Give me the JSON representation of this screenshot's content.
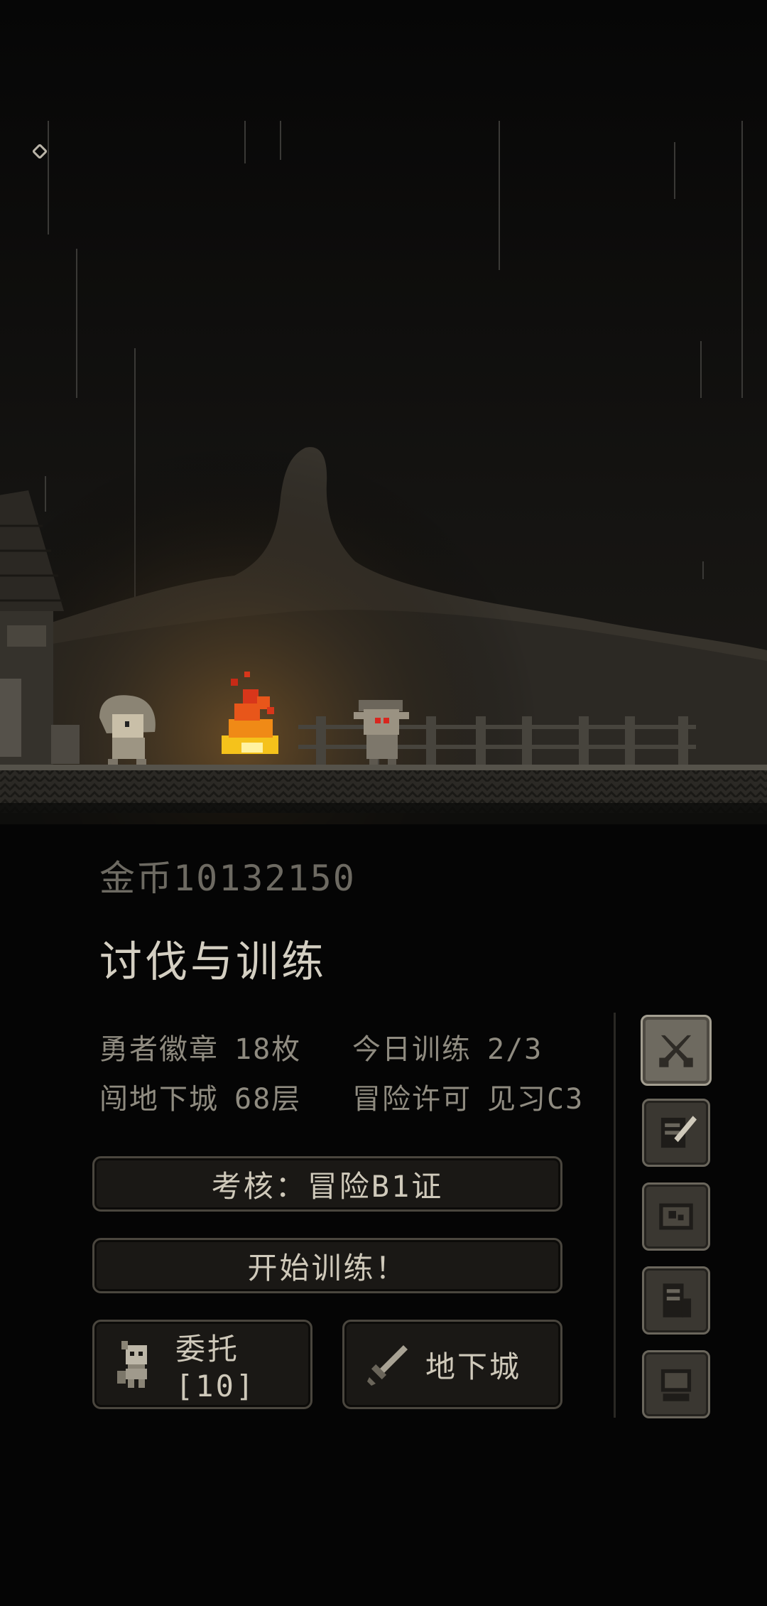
{
  "gold": "金币10132150",
  "panel_title": "讨伐与训练",
  "stats": [
    {
      "label": "勇者徽章",
      "value": "18枚"
    },
    {
      "label": "今日训练",
      "value": "2/3"
    },
    {
      "label": "闯地下城",
      "value": "68层"
    },
    {
      "label": "冒险许可",
      "value": "见习C3"
    }
  ],
  "buttons": {
    "exam": "考核：冒险B1证",
    "train": "开始训练！",
    "quest": "委托[10]",
    "dungeon": "地下城"
  },
  "side_menu": [
    {
      "icon": "crossed-swords-icon",
      "active": true
    },
    {
      "icon": "quill-scroll-icon",
      "active": false
    },
    {
      "icon": "map-icon",
      "active": false
    },
    {
      "icon": "book-icon",
      "active": false
    },
    {
      "icon": "computer-icon",
      "active": false
    }
  ],
  "colors": {
    "background": "#050505",
    "fire": "#f2a21a",
    "enemy_eye": "#d8261e",
    "button_face": "#1a1815"
  }
}
